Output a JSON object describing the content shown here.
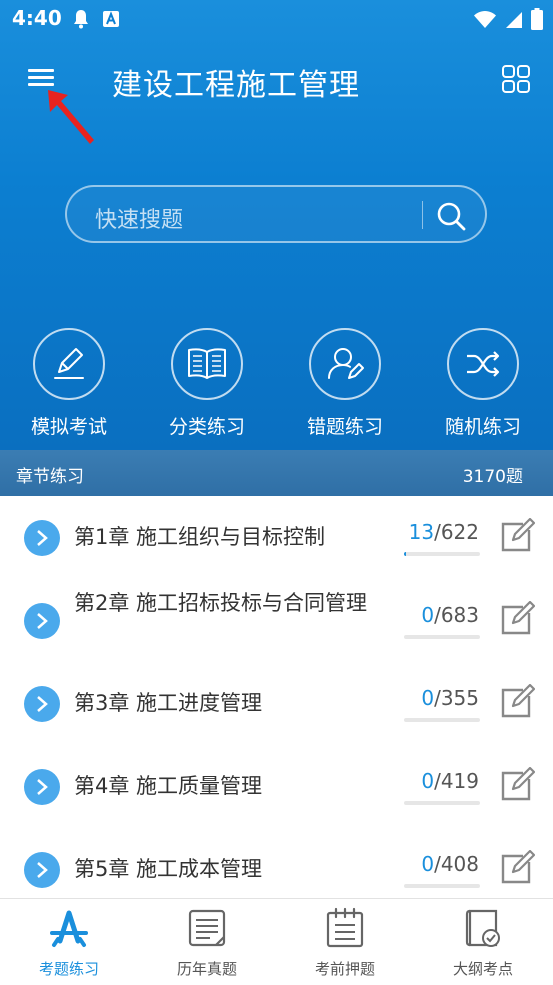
{
  "status": {
    "time": "4:40"
  },
  "header": {
    "title": "建设工程施工管理"
  },
  "search": {
    "placeholder": "快速搜题"
  },
  "quick_actions": [
    {
      "label": "模拟考试",
      "icon": "pencil-icon"
    },
    {
      "label": "分类练习",
      "icon": "book-icon"
    },
    {
      "label": "错题练习",
      "icon": "user-edit-icon"
    },
    {
      "label": "随机练习",
      "icon": "shuffle-icon"
    }
  ],
  "section": {
    "title": "章节练习",
    "count": "3170题"
  },
  "chapters": [
    {
      "title": "第1章 施工组织与目标控制",
      "done": "13",
      "total": "/622",
      "progress": 0.021
    },
    {
      "title": "第2章 施工招标投标与合同管理",
      "done": "0",
      "total": "/683",
      "progress": 0
    },
    {
      "title": "第3章 施工进度管理",
      "done": "0",
      "total": "/355",
      "progress": 0
    },
    {
      "title": "第4章 施工质量管理",
      "done": "0",
      "total": "/419",
      "progress": 0
    },
    {
      "title": "第5章 施工成本管理",
      "done": "0",
      "total": "/408",
      "progress": 0
    }
  ],
  "tabs": [
    {
      "label": "考题练习",
      "icon": "exam-icon",
      "active": true
    },
    {
      "label": "历年真题",
      "icon": "document-icon",
      "active": false
    },
    {
      "label": "考前押题",
      "icon": "calendar-list-icon",
      "active": false
    },
    {
      "label": "大纲考点",
      "icon": "outline-check-icon",
      "active": false
    }
  ],
  "colors": {
    "primary": "#1a8fdc",
    "header_bg": "#0c7fd1",
    "annotation": "#e8231f"
  }
}
